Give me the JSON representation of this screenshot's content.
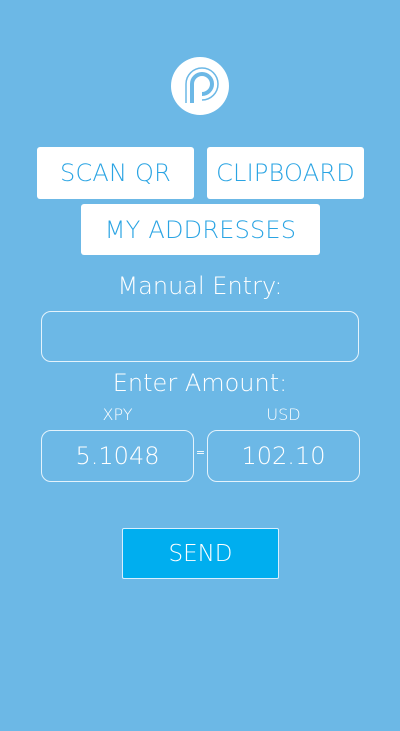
{
  "logo": {
    "icon": "p-logo-icon"
  },
  "buttons": {
    "scan_qr": "SCAN QR",
    "clipboard": "CLIPBOARD",
    "my_addresses": "MY ADDRESSES",
    "send": "SEND"
  },
  "manual_entry": {
    "label": "Manual Entry:",
    "value": ""
  },
  "amount": {
    "label": "Enter Amount:",
    "xpy_label": "XPY",
    "usd_label": "USD",
    "xpy_value": "5.1048",
    "usd_value": "102.10",
    "equals": "="
  },
  "colors": {
    "background": "#6cb8e6",
    "accent": "#2aa4e3",
    "send": "#00aeef"
  }
}
